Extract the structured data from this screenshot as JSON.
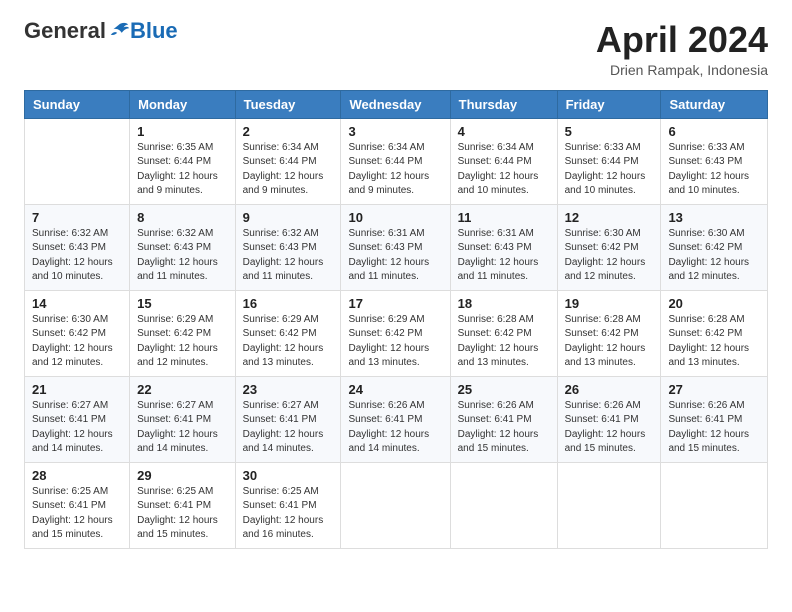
{
  "header": {
    "logo_general": "General",
    "logo_blue": "Blue",
    "month_title": "April 2024",
    "subtitle": "Drien Rampak, Indonesia"
  },
  "weekdays": [
    "Sunday",
    "Monday",
    "Tuesday",
    "Wednesday",
    "Thursday",
    "Friday",
    "Saturday"
  ],
  "weeks": [
    [
      {
        "day": "",
        "sunrise": "",
        "sunset": "",
        "daylight": ""
      },
      {
        "day": "1",
        "sunrise": "Sunrise: 6:35 AM",
        "sunset": "Sunset: 6:44 PM",
        "daylight": "Daylight: 12 hours and 9 minutes."
      },
      {
        "day": "2",
        "sunrise": "Sunrise: 6:34 AM",
        "sunset": "Sunset: 6:44 PM",
        "daylight": "Daylight: 12 hours and 9 minutes."
      },
      {
        "day": "3",
        "sunrise": "Sunrise: 6:34 AM",
        "sunset": "Sunset: 6:44 PM",
        "daylight": "Daylight: 12 hours and 9 minutes."
      },
      {
        "day": "4",
        "sunrise": "Sunrise: 6:34 AM",
        "sunset": "Sunset: 6:44 PM",
        "daylight": "Daylight: 12 hours and 10 minutes."
      },
      {
        "day": "5",
        "sunrise": "Sunrise: 6:33 AM",
        "sunset": "Sunset: 6:44 PM",
        "daylight": "Daylight: 12 hours and 10 minutes."
      },
      {
        "day": "6",
        "sunrise": "Sunrise: 6:33 AM",
        "sunset": "Sunset: 6:43 PM",
        "daylight": "Daylight: 12 hours and 10 minutes."
      }
    ],
    [
      {
        "day": "7",
        "sunrise": "Sunrise: 6:32 AM",
        "sunset": "Sunset: 6:43 PM",
        "daylight": "Daylight: 12 hours and 10 minutes."
      },
      {
        "day": "8",
        "sunrise": "Sunrise: 6:32 AM",
        "sunset": "Sunset: 6:43 PM",
        "daylight": "Daylight: 12 hours and 11 minutes."
      },
      {
        "day": "9",
        "sunrise": "Sunrise: 6:32 AM",
        "sunset": "Sunset: 6:43 PM",
        "daylight": "Daylight: 12 hours and 11 minutes."
      },
      {
        "day": "10",
        "sunrise": "Sunrise: 6:31 AM",
        "sunset": "Sunset: 6:43 PM",
        "daylight": "Daylight: 12 hours and 11 minutes."
      },
      {
        "day": "11",
        "sunrise": "Sunrise: 6:31 AM",
        "sunset": "Sunset: 6:43 PM",
        "daylight": "Daylight: 12 hours and 11 minutes."
      },
      {
        "day": "12",
        "sunrise": "Sunrise: 6:30 AM",
        "sunset": "Sunset: 6:42 PM",
        "daylight": "Daylight: 12 hours and 12 minutes."
      },
      {
        "day": "13",
        "sunrise": "Sunrise: 6:30 AM",
        "sunset": "Sunset: 6:42 PM",
        "daylight": "Daylight: 12 hours and 12 minutes."
      }
    ],
    [
      {
        "day": "14",
        "sunrise": "Sunrise: 6:30 AM",
        "sunset": "Sunset: 6:42 PM",
        "daylight": "Daylight: 12 hours and 12 minutes."
      },
      {
        "day": "15",
        "sunrise": "Sunrise: 6:29 AM",
        "sunset": "Sunset: 6:42 PM",
        "daylight": "Daylight: 12 hours and 12 minutes."
      },
      {
        "day": "16",
        "sunrise": "Sunrise: 6:29 AM",
        "sunset": "Sunset: 6:42 PM",
        "daylight": "Daylight: 12 hours and 13 minutes."
      },
      {
        "day": "17",
        "sunrise": "Sunrise: 6:29 AM",
        "sunset": "Sunset: 6:42 PM",
        "daylight": "Daylight: 12 hours and 13 minutes."
      },
      {
        "day": "18",
        "sunrise": "Sunrise: 6:28 AM",
        "sunset": "Sunset: 6:42 PM",
        "daylight": "Daylight: 12 hours and 13 minutes."
      },
      {
        "day": "19",
        "sunrise": "Sunrise: 6:28 AM",
        "sunset": "Sunset: 6:42 PM",
        "daylight": "Daylight: 12 hours and 13 minutes."
      },
      {
        "day": "20",
        "sunrise": "Sunrise: 6:28 AM",
        "sunset": "Sunset: 6:42 PM",
        "daylight": "Daylight: 12 hours and 13 minutes."
      }
    ],
    [
      {
        "day": "21",
        "sunrise": "Sunrise: 6:27 AM",
        "sunset": "Sunset: 6:41 PM",
        "daylight": "Daylight: 12 hours and 14 minutes."
      },
      {
        "day": "22",
        "sunrise": "Sunrise: 6:27 AM",
        "sunset": "Sunset: 6:41 PM",
        "daylight": "Daylight: 12 hours and 14 minutes."
      },
      {
        "day": "23",
        "sunrise": "Sunrise: 6:27 AM",
        "sunset": "Sunset: 6:41 PM",
        "daylight": "Daylight: 12 hours and 14 minutes."
      },
      {
        "day": "24",
        "sunrise": "Sunrise: 6:26 AM",
        "sunset": "Sunset: 6:41 PM",
        "daylight": "Daylight: 12 hours and 14 minutes."
      },
      {
        "day": "25",
        "sunrise": "Sunrise: 6:26 AM",
        "sunset": "Sunset: 6:41 PM",
        "daylight": "Daylight: 12 hours and 15 minutes."
      },
      {
        "day": "26",
        "sunrise": "Sunrise: 6:26 AM",
        "sunset": "Sunset: 6:41 PM",
        "daylight": "Daylight: 12 hours and 15 minutes."
      },
      {
        "day": "27",
        "sunrise": "Sunrise: 6:26 AM",
        "sunset": "Sunset: 6:41 PM",
        "daylight": "Daylight: 12 hours and 15 minutes."
      }
    ],
    [
      {
        "day": "28",
        "sunrise": "Sunrise: 6:25 AM",
        "sunset": "Sunset: 6:41 PM",
        "daylight": "Daylight: 12 hours and 15 minutes."
      },
      {
        "day": "29",
        "sunrise": "Sunrise: 6:25 AM",
        "sunset": "Sunset: 6:41 PM",
        "daylight": "Daylight: 12 hours and 15 minutes."
      },
      {
        "day": "30",
        "sunrise": "Sunrise: 6:25 AM",
        "sunset": "Sunset: 6:41 PM",
        "daylight": "Daylight: 12 hours and 16 minutes."
      },
      {
        "day": "",
        "sunrise": "",
        "sunset": "",
        "daylight": ""
      },
      {
        "day": "",
        "sunrise": "",
        "sunset": "",
        "daylight": ""
      },
      {
        "day": "",
        "sunrise": "",
        "sunset": "",
        "daylight": ""
      },
      {
        "day": "",
        "sunrise": "",
        "sunset": "",
        "daylight": ""
      }
    ]
  ]
}
